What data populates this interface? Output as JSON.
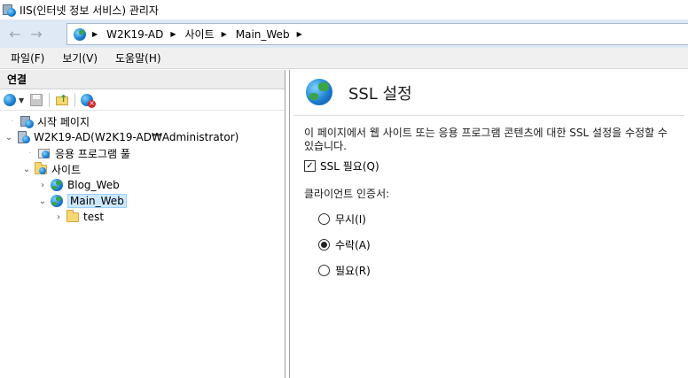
{
  "window": {
    "title": "IIS(인터넷 정보 서비스) 관리자"
  },
  "navigation": {
    "back_icon": "arrow-left-icon",
    "forward_icon": "arrow-right-icon",
    "breadcrumb": [
      "W2K19-AD",
      "사이트",
      "Main_Web"
    ]
  },
  "menu": {
    "items": [
      "파일(F)",
      "보기(V)",
      "도움말(H)"
    ]
  },
  "connections": {
    "header": "연결",
    "tree": [
      {
        "label": "시작 페이지",
        "icon": "start-page-icon",
        "level": 0,
        "expanded": null,
        "selected": false
      },
      {
        "label": "W2K19-AD(W2K19-AD₩Administrator)",
        "icon": "server-icon",
        "level": 0,
        "expanded": true,
        "selected": false
      },
      {
        "label": "응용 프로그램 풀",
        "icon": "app-pool-icon",
        "level": 1,
        "expanded": null,
        "selected": false
      },
      {
        "label": "사이트",
        "icon": "sites-folder-icon",
        "level": 1,
        "expanded": true,
        "selected": false
      },
      {
        "label": "Blog_Web",
        "icon": "globe-icon",
        "level": 2,
        "expanded": false,
        "selected": false
      },
      {
        "label": "Main_Web",
        "icon": "globe-icon",
        "level": 2,
        "expanded": true,
        "selected": true
      },
      {
        "label": "test",
        "icon": "folder-icon",
        "level": 3,
        "expanded": false,
        "selected": false
      }
    ]
  },
  "feature": {
    "title": "SSL 설정",
    "description": "이 페이지에서 웹 사이트 또는 응용 프로그램 콘텐츠에 대한 SSL 설정을 수정할 수 있습니다.",
    "require_ssl": {
      "label": "SSL 필요(Q)",
      "checked": true
    },
    "client_cert_label": "클라이언트 인증서:",
    "client_cert_options": [
      {
        "label": "무시(I)",
        "selected": false
      },
      {
        "label": "수락(A)",
        "selected": true
      },
      {
        "label": "필요(R)",
        "selected": false
      }
    ]
  },
  "colors": {
    "nav_background": "#dfe9f5",
    "selection": "#cce8ff"
  }
}
